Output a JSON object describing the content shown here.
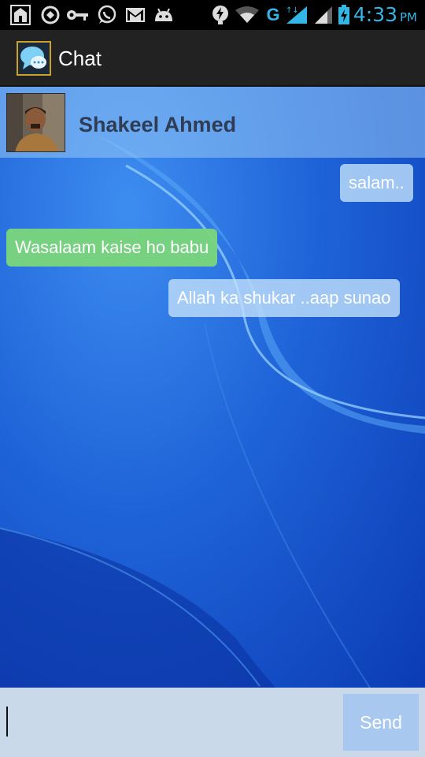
{
  "status_bar": {
    "time": "4:33",
    "ampm": "PM",
    "network": "G",
    "accent_color": "#33b5e5",
    "icons": [
      "prayer-app-icon",
      "sync-icon",
      "key-icon",
      "whatsapp-icon",
      "gmail-icon",
      "android-debug-icon",
      "battery-saver-icon",
      "wifi-icon",
      "signal-icon",
      "battery-icon"
    ]
  },
  "action_bar": {
    "title": "Chat",
    "icon": "chat-bubbles-icon"
  },
  "contact": {
    "name": "Shakeel Ahmed",
    "avatar": "contact-photo"
  },
  "messages": [
    {
      "direction": "outgoing",
      "text": "salam.."
    },
    {
      "direction": "incoming",
      "text": "Wasalaam kaise ho babu"
    },
    {
      "direction": "outgoing",
      "text": "Allah ka shukar ..aap sunao"
    }
  ],
  "composer": {
    "message_value": "",
    "send_label": "Send"
  },
  "colors": {
    "outgoing_bubble": "#bedefa",
    "incoming_bubble": "#7ad67a",
    "chat_background": "#1f63d8"
  }
}
